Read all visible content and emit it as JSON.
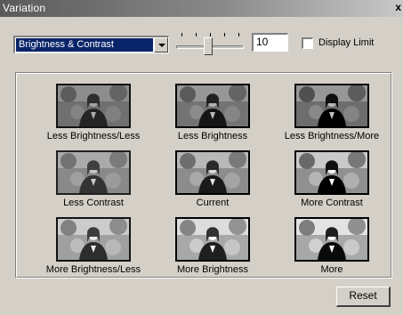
{
  "window": {
    "title": "Variation",
    "close_symbol": "x"
  },
  "controls": {
    "mode_selected": "Brightness & Contrast",
    "slider_level_fraction": 0.47,
    "slider_tick_count": 5,
    "step_value": "10",
    "display_limit_label": "Display Limit",
    "display_limit_checked": false
  },
  "variations": [
    {
      "label": "Less Brightness/Less",
      "brightness": 0.78,
      "contrast": 0.85
    },
    {
      "label": "Less Brightness",
      "brightness": 0.82,
      "contrast": 1.0
    },
    {
      "label": "Less Brightness/More",
      "brightness": 0.8,
      "contrast": 1.2
    },
    {
      "label": "Less Contrast",
      "brightness": 1.0,
      "contrast": 0.75
    },
    {
      "label": "Current",
      "brightness": 1.0,
      "contrast": 1.0
    },
    {
      "label": "More Contrast",
      "brightness": 1.0,
      "contrast": 1.3
    },
    {
      "label": "More Brightness/Less",
      "brightness": 1.18,
      "contrast": 0.85
    },
    {
      "label": "More Brightness",
      "brightness": 1.2,
      "contrast": 1.0
    },
    {
      "label": "More",
      "brightness": 1.15,
      "contrast": 1.2
    }
  ],
  "buttons": {
    "reset_label": "Reset"
  },
  "icons": {
    "dropdown_arrow": "chevron-down-icon"
  }
}
